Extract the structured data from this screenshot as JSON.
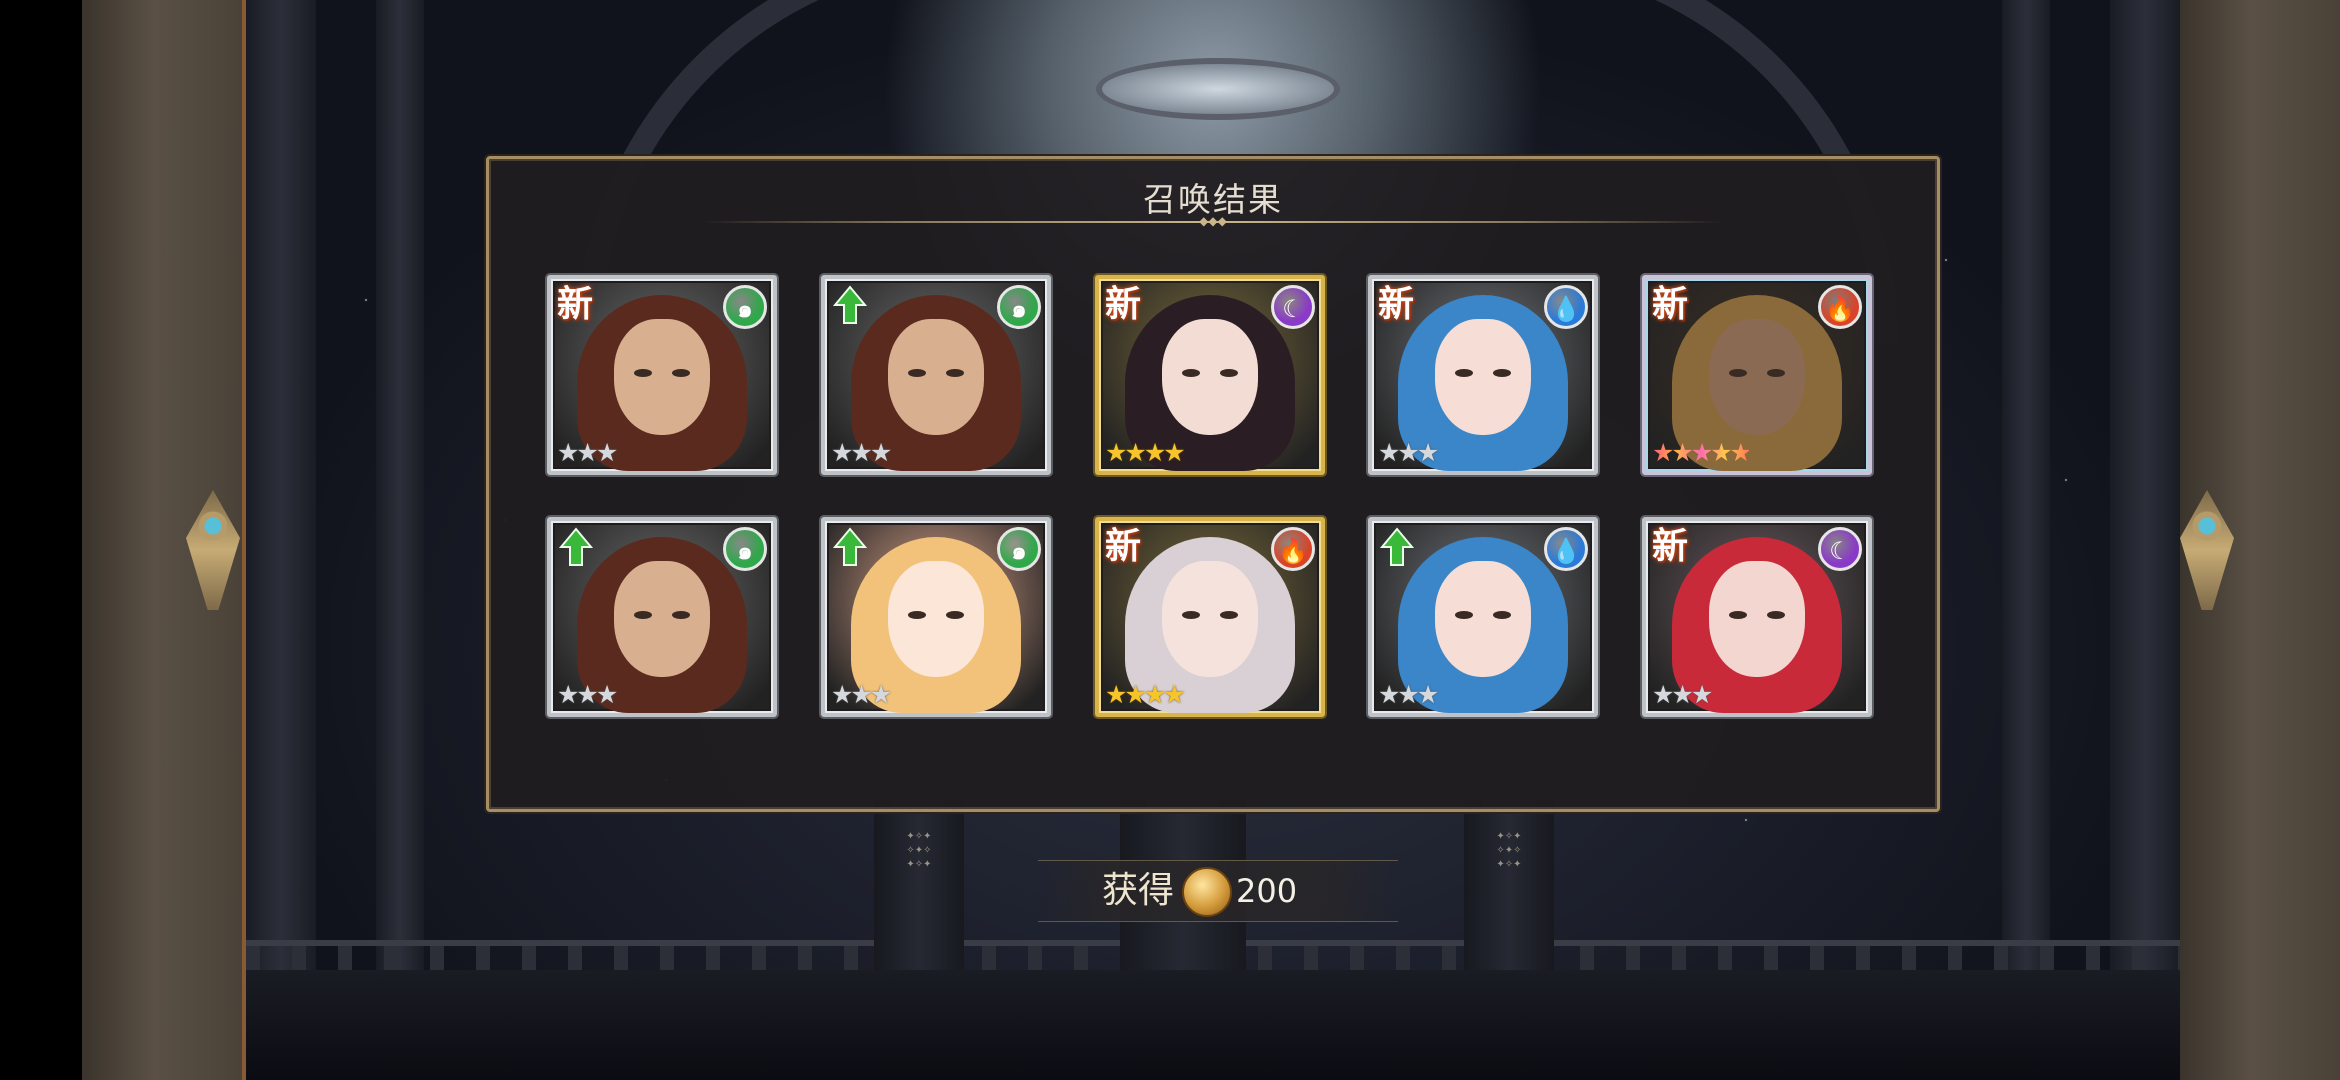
{
  "panel": {
    "title": "召唤结果"
  },
  "badges": {
    "new_label": "新"
  },
  "cards": [
    {
      "badge": "new",
      "element": "wind",
      "rarity": 3,
      "frame": "silver",
      "hair": "#5a2a1e",
      "skin": "#d8b090",
      "bg": "#6a6a6a"
    },
    {
      "badge": "up",
      "element": "wind",
      "rarity": 3,
      "frame": "silver",
      "hair": "#5a2a1e",
      "skin": "#d8b090",
      "bg": "#6a6a6a"
    },
    {
      "badge": "new",
      "element": "dark",
      "rarity": 4,
      "frame": "gold",
      "hair": "#2a1e24",
      "skin": "#f3dcd4",
      "bg": "#7a6a3a"
    },
    {
      "badge": "new",
      "element": "water",
      "rarity": 3,
      "frame": "silver",
      "hair": "#3a86c8",
      "skin": "#f6ddd6",
      "bg": "#6e7278"
    },
    {
      "badge": "new",
      "element": "fire",
      "rarity": 5,
      "frame": "rainbow",
      "hair": "#8a6a3a",
      "skin": "#8a6a52",
      "bg": "#3a2e24"
    },
    {
      "badge": "up",
      "element": "wind",
      "rarity": 3,
      "frame": "silver",
      "hair": "#5a2a1e",
      "skin": "#d8b090",
      "bg": "#6a6a6a"
    },
    {
      "badge": "up",
      "element": "wind",
      "rarity": 3,
      "frame": "silver",
      "hair": "#f2c27a",
      "skin": "#fbe6d8",
      "bg": "#d8a28a"
    },
    {
      "badge": "new",
      "element": "fire",
      "rarity": 4,
      "frame": "gold",
      "hair": "#d8d0d4",
      "skin": "#f6e2dc",
      "bg": "#7a6a3a"
    },
    {
      "badge": "up",
      "element": "water",
      "rarity": 3,
      "frame": "silver",
      "hair": "#3a86c8",
      "skin": "#f6ddd6",
      "bg": "#6e7278"
    },
    {
      "badge": "new",
      "element": "dark",
      "rarity": 3,
      "frame": "silver",
      "hair": "#c82a3a",
      "skin": "#f4d6d0",
      "bg": "#6a5a5e"
    }
  ],
  "element_icons": {
    "wind": {
      "glyph": "๑",
      "color": "#2fa84a",
      "name": "wind-element-icon"
    },
    "dark": {
      "glyph": "☾",
      "color": "#8a3ac8",
      "name": "dark-element-icon"
    },
    "water": {
      "glyph": "💧",
      "color": "#2a7ad8",
      "name": "water-element-icon"
    },
    "fire": {
      "glyph": "🔥",
      "color": "#d8442a",
      "name": "fire-element-icon"
    }
  },
  "reward": {
    "label": "获得",
    "icon": "coin-icon",
    "amount": "200"
  },
  "colors": {
    "badge_up_arrow": "#3ab83a",
    "panel_border": "#a58d66"
  }
}
